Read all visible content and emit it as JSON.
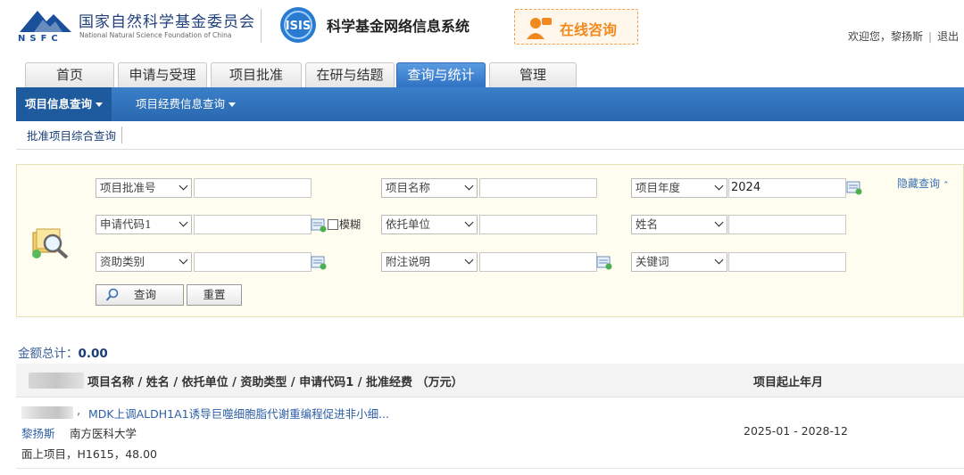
{
  "header": {
    "org_name_cn": "国家自然科学基金委员会",
    "org_name_en": "National Natural Science Foundation of China",
    "logo_text": "NSFC",
    "system_logo_text": "ISIS",
    "system_title": "科学基金网络信息系统",
    "consult_label": "在线咨询",
    "welcome_text": "欢迎您，黎扬斯",
    "separator": "|",
    "logout_label": "退出"
  },
  "tabs": [
    {
      "label": "首页"
    },
    {
      "label": "申请与受理"
    },
    {
      "label": "项目批准"
    },
    {
      "label": "在研与结题"
    },
    {
      "label": "查询与统计"
    },
    {
      "label": "管理"
    }
  ],
  "subnav": {
    "items": [
      {
        "label": "项目信息查询"
      },
      {
        "label": "项目经费信息查询"
      }
    ]
  },
  "breadcrumb": {
    "label": "批准项目综合查询"
  },
  "search": {
    "hide_label": "隐藏查询",
    "fields": [
      {
        "select": "项目批准号",
        "value": ""
      },
      {
        "select": "项目名称",
        "value": ""
      },
      {
        "select": "项目年度",
        "value": "2024"
      },
      {
        "select": "申请代码1",
        "value": ""
      },
      {
        "select": "依托单位",
        "value": ""
      },
      {
        "select": "姓名",
        "value": ""
      },
      {
        "select": "资助类别",
        "value": ""
      },
      {
        "select": "附注说明",
        "value": ""
      },
      {
        "select": "关键词",
        "value": ""
      }
    ],
    "fuzzy_label": "模糊",
    "query_button": "查询",
    "reset_button": "重置"
  },
  "totals": {
    "label": "金额总计：",
    "value": "0.00"
  },
  "results": {
    "columns": {
      "title": "项目名称 / 姓名 / 依托单位 / 资助类型 / 申请代码1 / 批准经费 （万元）",
      "period": "项目起止年月"
    },
    "rows": [
      {
        "title": "MDK上调ALDH1A1诱导巨噬细胞脂代谢重编程促进非小细...",
        "person": "黎扬斯",
        "institution": "南方医科大学",
        "meta": "面上项目，H1615，48.00",
        "period": "2025-01 - 2028-12"
      }
    ]
  },
  "colors": {
    "tab_active": "#2f72c4",
    "subnav": "#2a68b0",
    "link": "#2d5fa6",
    "consult": "#f08a1e",
    "panel_bg": "#fffdf0"
  }
}
